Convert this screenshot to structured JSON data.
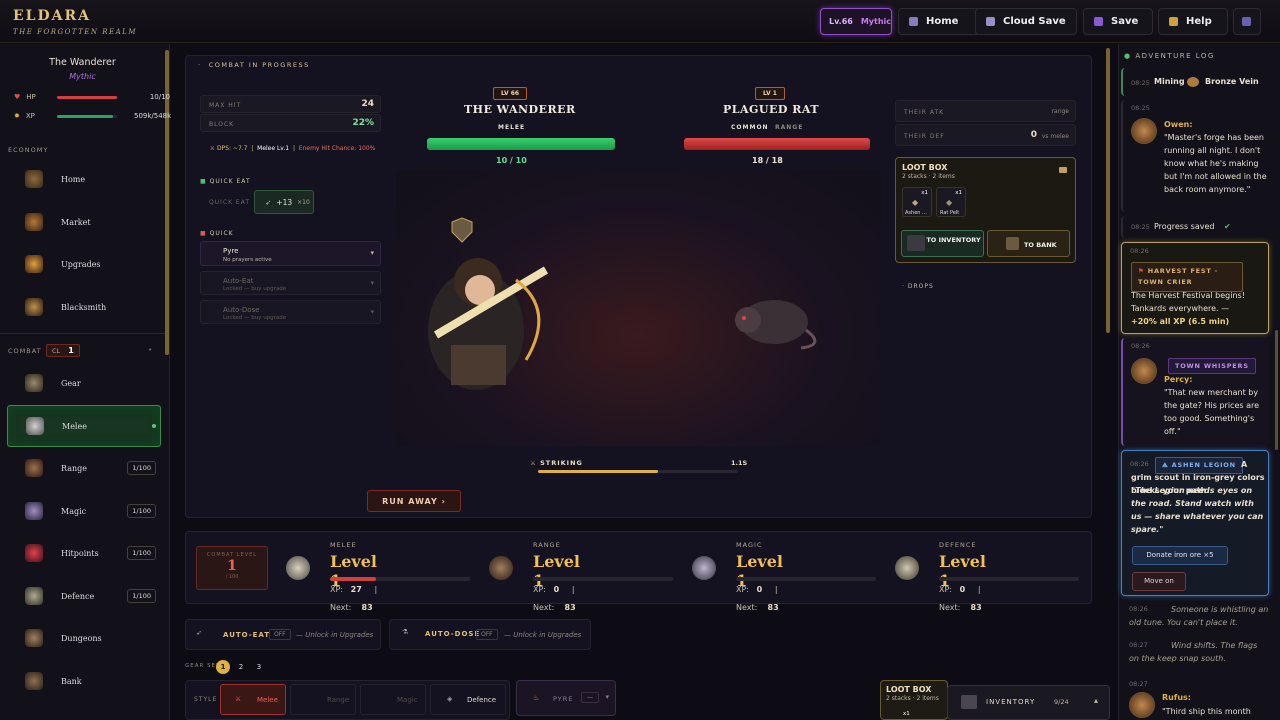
{
  "app": {
    "title": "ELDARA",
    "subtitle": "THE FORGOTTEN REALM"
  },
  "topbar": {
    "level_badge": "Lv.66",
    "level_rank": "Mythic",
    "home": "Home",
    "cloud_save": "Cloud Save",
    "save": "Save",
    "help": "Help"
  },
  "player": {
    "name": "The Wanderer",
    "rank": "Mythic",
    "hp_label": "HP",
    "hp_value": "10/10",
    "hp_fraction": 1.0,
    "xp_label": "XP",
    "xp_value": "509k/548k",
    "xp_fraction": 0.93
  },
  "sidebar": {
    "economy_label": "ECONOMY",
    "economy": [
      {
        "label": "Home"
      },
      {
        "label": "Market"
      },
      {
        "label": "Upgrades"
      },
      {
        "label": "Blacksmith"
      }
    ],
    "combat_label": "COMBAT",
    "cl_label": "CL",
    "cl_value": "1",
    "combat": [
      {
        "label": "Gear",
        "count": ""
      },
      {
        "label": "Melee",
        "count": ""
      },
      {
        "label": "Range",
        "count": "1/100"
      },
      {
        "label": "Magic",
        "count": "1/100"
      },
      {
        "label": "Hitpoints",
        "count": "1/100"
      },
      {
        "label": "Defence",
        "count": "1/100"
      },
      {
        "label": "Dungeons",
        "count": ""
      },
      {
        "label": "Bank",
        "count": ""
      }
    ]
  },
  "combat": {
    "title": "COMBAT IN PROGRESS",
    "max_hit_label": "MAX HIT",
    "max_hit": "24",
    "block_label": "BLOCK",
    "block": "22%",
    "dps_line": "DPS: ~7.7",
    "dps_sep": "Melee Lv.1",
    "enemy_hit": "Enemy Hit Chance: 100%",
    "quick_eat_section": "QUICK EAT",
    "quick_eat_label": "QUICK EAT",
    "quick_eat_value": "+13",
    "quick_eat_count": "×10",
    "quick_section": "QUICK",
    "pyre": {
      "title": "Pyre",
      "sub": "No prayers active"
    },
    "auto_eat": {
      "title": "Auto-Eat",
      "sub": "Locked — buy upgrade"
    },
    "auto_dose": {
      "title": "Auto-Dose",
      "sub": "Locked — buy upgrade"
    },
    "player": {
      "level": "LV 66",
      "name": "THE WANDERER",
      "style": "MELEE",
      "hp_text": "10 / 10",
      "hp_fraction": 1.0
    },
    "enemy": {
      "level": "LV 1",
      "name": "PLAGUED RAT",
      "rarity": "COMMON",
      "style": "RANGE",
      "hp_text": "18 / 18",
      "hp_fraction": 1.0
    },
    "their_atk_label": "THEIR ATK",
    "their_atk_value": "range",
    "their_def_label": "THEIR DEF",
    "their_def_value": "0",
    "their_def_vs": "vs melee",
    "loot": {
      "title": "LOOT BOX",
      "sub": "2 stacks · 2 items",
      "items": [
        {
          "name": "Ashen ...",
          "qty": "x1"
        },
        {
          "name": "Rat Pelt",
          "qty": "x1"
        }
      ],
      "to_inventory": "TO INVENTORY",
      "to_bank": "TO BANK"
    },
    "drops_label": "DROPS",
    "striking_label": "STRIKING",
    "striking_time": "1.1S",
    "striking_fraction": 0.6,
    "run_away": "RUN AWAY ›"
  },
  "skills": {
    "combat_level_label": "COMBAT LEVEL",
    "combat_level": "1",
    "combat_level_max": "/ 100",
    "items": [
      {
        "name": "MELEE",
        "level": "Level 1",
        "xp": "27",
        "next": "83",
        "fraction": 0.33
      },
      {
        "name": "RANGE",
        "level": "Level 1",
        "xp": "0",
        "next": "83",
        "fraction": 0
      },
      {
        "name": "MAGIC",
        "level": "Level 1",
        "xp": "0",
        "next": "83",
        "fraction": 0
      },
      {
        "name": "DEFENCE",
        "level": "Level 1",
        "xp": "0",
        "next": "83",
        "fraction": 0
      }
    ],
    "xp_label": "XP:",
    "next_label": "Next:"
  },
  "toggles": {
    "auto_eat": "AUTO-EAT",
    "auto_eat_state": "OFF",
    "auto_eat_note": "— Unlock in Upgrades",
    "auto_dose": "AUTO-DOSE",
    "auto_dose_state": "OFF",
    "auto_dose_note": "— Unlock in Upgrades"
  },
  "gearset": {
    "label": "GEAR SET",
    "sets": [
      "1",
      "2",
      "3"
    ],
    "style_label": "STYLE",
    "styles": [
      "Melee",
      "Range",
      "Magic",
      "Defence"
    ],
    "pyre": "PYRE",
    "pyre_value": "—"
  },
  "log": {
    "title": "ADVENTURE LOG",
    "e1": {
      "time": "08:25",
      "text": "Mining",
      "item": "Bronze Vein"
    },
    "e2": {
      "time": "08:25",
      "speaker": "Owen:",
      "text": "\"Master's forge has been running all night. I don't know what he's making but I'm not allowed in the back room anymore.\""
    },
    "e3": {
      "time": "08:25",
      "text": "Progress saved"
    },
    "e4": {
      "time": "08:26",
      "tag": "HARVEST FEST · TOWN CRIER",
      "text": "The Harvest Festival begins! Tankards everywhere. —",
      "bonus": "+20% all XP (6.5 min)"
    },
    "e5": {
      "time": "08:26",
      "tag": "TOWN WHISPERS",
      "speaker": "Percy:",
      "text": "\"That new merchant by the gate? His prices are too good. Something's off.\""
    },
    "e6": {
      "time": "08:26",
      "tag": "ASHEN LEGION",
      "text_a": "A grim scout in iron-grey colors blocks your path.",
      "text_b": "\"The Legion needs eyes on the road. Stand watch with us — share whatever you can spare.\"",
      "btn1": "Donate iron ore ×5",
      "btn2": "Move on"
    },
    "e7": {
      "time": "08:26",
      "text": "Someone is whistling an old tune. You can't place it."
    },
    "e8": {
      "time": "08:27",
      "text": "Wind shifts. The flags on the keep snap south."
    },
    "e9": {
      "time": "08:27",
      "speaker": "Rufus:",
      "text": "\"Third ship this month"
    }
  },
  "bottom": {
    "loot_title": "LOOT BOX",
    "loot_sub": "2 stacks · 2 items",
    "loot_qty": "x1",
    "inventory": "INVENTORY",
    "inventory_count": "9/24"
  }
}
